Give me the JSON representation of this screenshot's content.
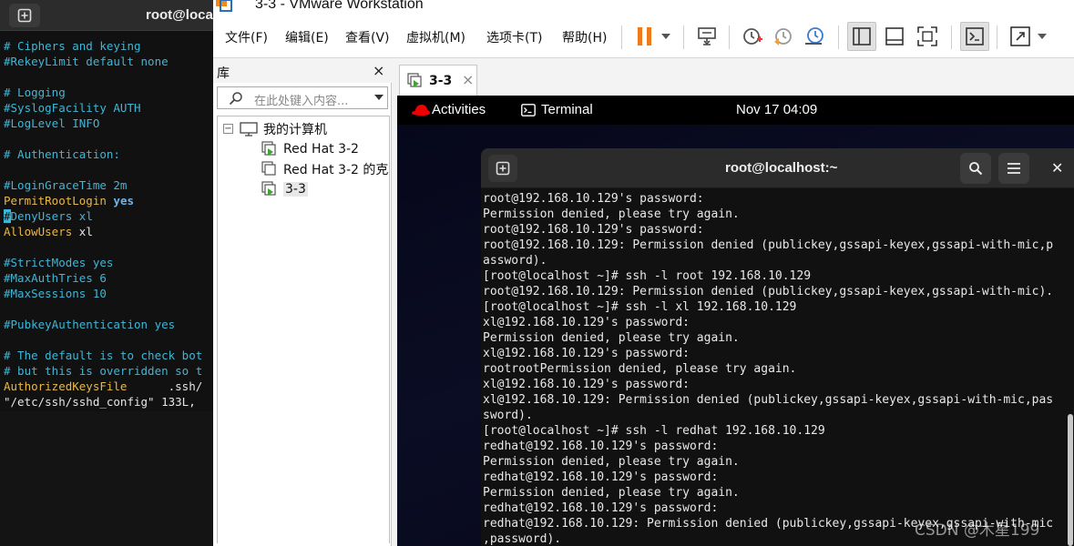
{
  "bg_terminal": {
    "title": "root@loca",
    "vim_lines": [
      {
        "parts": [
          {
            "t": "# Ciphers and keying",
            "c": "c-comment"
          }
        ]
      },
      {
        "parts": [
          {
            "t": "#RekeyLimit default none",
            "c": "c-comment"
          }
        ]
      },
      {
        "parts": [
          {
            "t": "",
            "c": "c-val"
          }
        ]
      },
      {
        "parts": [
          {
            "t": "# Logging",
            "c": "c-comment"
          }
        ]
      },
      {
        "parts": [
          {
            "t": "#SyslogFacility AUTH",
            "c": "c-comment"
          }
        ]
      },
      {
        "parts": [
          {
            "t": "#LogLevel INFO",
            "c": "c-comment"
          }
        ]
      },
      {
        "parts": [
          {
            "t": "",
            "c": "c-val"
          }
        ]
      },
      {
        "parts": [
          {
            "t": "# Authentication:",
            "c": "c-comment"
          }
        ]
      },
      {
        "parts": [
          {
            "t": "",
            "c": "c-val"
          }
        ]
      },
      {
        "parts": [
          {
            "t": "#LoginGraceTime 2m",
            "c": "c-comment"
          }
        ]
      },
      {
        "parts": [
          {
            "t": "PermitRootLogin",
            "c": "c-key"
          },
          {
            "t": " yes",
            "c": "c-yes"
          }
        ]
      },
      {
        "parts": [
          {
            "t": "#",
            "c": "cursor"
          },
          {
            "t": "DenyUsers xl",
            "c": "c-comment"
          }
        ]
      },
      {
        "parts": [
          {
            "t": "AllowUsers",
            "c": "c-key"
          },
          {
            "t": " xl",
            "c": "c-val"
          }
        ]
      },
      {
        "parts": [
          {
            "t": "",
            "c": "c-val"
          }
        ]
      },
      {
        "parts": [
          {
            "t": "#StrictModes yes",
            "c": "c-comment"
          }
        ]
      },
      {
        "parts": [
          {
            "t": "#MaxAuthTries 6",
            "c": "c-comment"
          }
        ]
      },
      {
        "parts": [
          {
            "t": "#MaxSessions 10",
            "c": "c-comment"
          }
        ]
      },
      {
        "parts": [
          {
            "t": "",
            "c": "c-val"
          }
        ]
      },
      {
        "parts": [
          {
            "t": "#PubkeyAuthentication yes",
            "c": "c-comment"
          }
        ]
      },
      {
        "parts": [
          {
            "t": "",
            "c": "c-val"
          }
        ]
      },
      {
        "parts": [
          {
            "t": "# The default is to check bot",
            "c": "c-comment"
          }
        ]
      },
      {
        "parts": [
          {
            "t": "# but this is overridden so t",
            "c": "c-comment"
          }
        ]
      },
      {
        "parts": [
          {
            "t": "AuthorizedKeysFile",
            "c": "c-key"
          },
          {
            "t": "      .ssh/",
            "c": "c-val"
          }
        ]
      },
      {
        "parts": [
          {
            "t": "\"/etc/ssh/sshd_config\" 133L,",
            "c": "c-status"
          }
        ]
      }
    ]
  },
  "vmware": {
    "title": "3-3 - VMware Workstation",
    "menu": [
      "文件(F)",
      "编辑(E)",
      "查看(V)",
      "虚拟机(M)",
      "选项卡(T)",
      "帮助(H)"
    ],
    "library": {
      "title": "库",
      "close": "×",
      "search_placeholder": "在此处键入内容...",
      "root": "我的计算机",
      "items": [
        "Red Hat 3-2",
        "Red Hat 3-2 的克",
        "3-3"
      ],
      "selected_index": 2
    },
    "tab": {
      "label": "3-3",
      "close": "×"
    },
    "guest": {
      "activities": "Activities",
      "app": "Terminal",
      "clock": "Nov 17  04:09",
      "terminal_title": "root@localhost:~",
      "lines": [
        "root@192.168.10.129's password:",
        "Permission denied, please try again.",
        "root@192.168.10.129's password:",
        "root@192.168.10.129: Permission denied (publickey,gssapi-keyex,gssapi-with-mic,p",
        "assword).",
        "[root@localhost ~]# ssh -l root 192.168.10.129",
        "root@192.168.10.129: Permission denied (publickey,gssapi-keyex,gssapi-with-mic).",
        "[root@localhost ~]# ssh -l xl 192.168.10.129",
        "xl@192.168.10.129's password:",
        "Permission denied, please try again.",
        "xl@192.168.10.129's password:",
        "rootrootPermission denied, please try again.",
        "xl@192.168.10.129's password:",
        "xl@192.168.10.129: Permission denied (publickey,gssapi-keyex,gssapi-with-mic,pas",
        "sword).",
        "[root@localhost ~]# ssh -l redhat 192.168.10.129",
        "redhat@192.168.10.129's password:",
        "Permission denied, please try again.",
        "redhat@192.168.10.129's password:",
        "Permission denied, please try again.",
        "redhat@192.168.10.129's password:",
        "redhat@192.168.10.129: Permission denied (publickey,gssapi-keyex,gssapi-with-mic",
        ",password)."
      ]
    }
  },
  "watermark": "CSDN @木星199",
  "colors": {
    "vim_comment": "#3fb6d6",
    "vim_keyword": "#e9b84a",
    "vim_yes": "#6fb4ea",
    "pause_orange": "#f07a1a",
    "redhat_red": "#ee0000",
    "vmware_green": "#3fa33a"
  },
  "icons": [
    "new-tab-icon",
    "vmware-app-icon",
    "pause-icon",
    "dropdown-arrow-icon",
    "send-ctrl-alt-del-icon",
    "snapshot-icon",
    "revert-snapshot-icon",
    "snapshot-manager-icon",
    "library-view-icon",
    "single-window-icon",
    "fullscreen-icon",
    "console-view-icon",
    "stretch-icon",
    "search-icon",
    "computer-icon",
    "vm-icon",
    "redhat-icon",
    "terminal-icon",
    "menu-icon",
    "close-icon"
  ]
}
